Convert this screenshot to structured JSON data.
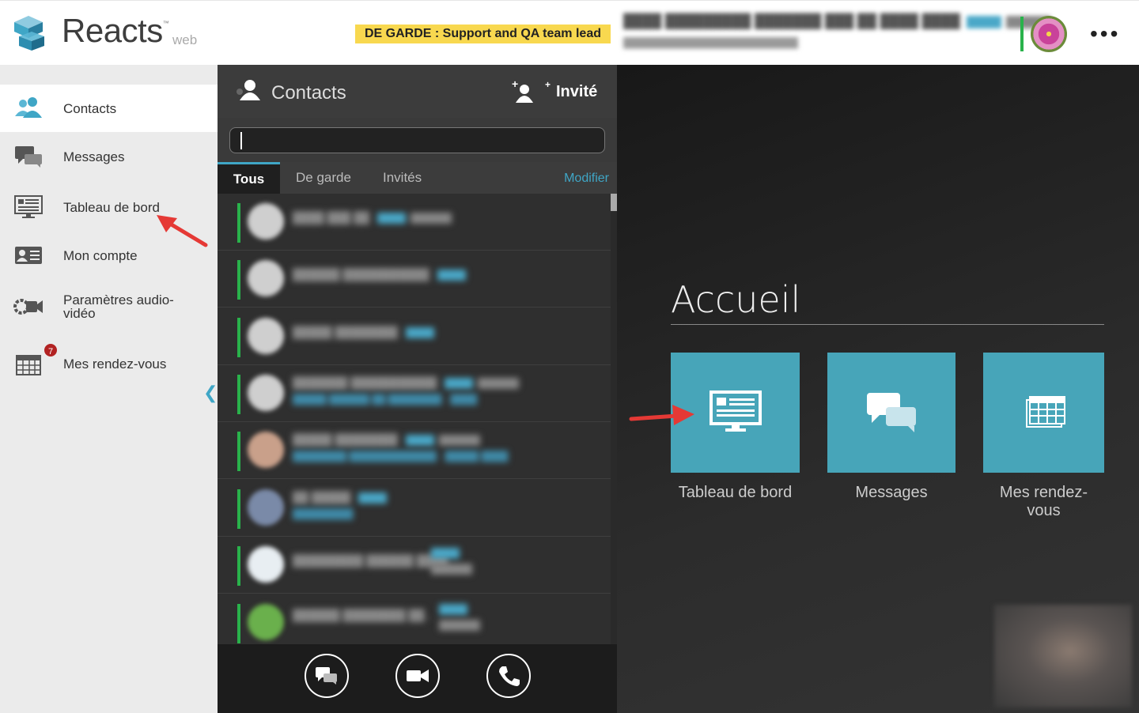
{
  "header": {
    "brand": "Reacts",
    "brand_tm": "™",
    "brand_suffix": "web",
    "oncall_banner": "DE GARDE : Support and QA team lead"
  },
  "sidebar": {
    "items": [
      {
        "label": "Contacts",
        "icon": "contacts-icon",
        "active": true
      },
      {
        "label": "Messages",
        "icon": "messages-icon"
      },
      {
        "label": "Tableau de bord",
        "icon": "dashboard-icon"
      },
      {
        "label": "Mon compte",
        "icon": "account-card-icon"
      },
      {
        "label": "Paramètres audio-vidéo",
        "icon": "camera-settings-icon"
      },
      {
        "label": "Mes rendez-vous",
        "icon": "calendar-icon",
        "badge": "7"
      }
    ],
    "collapse_glyph": "❮"
  },
  "contacts_panel": {
    "title": "Contacts",
    "invite_label": "Invité",
    "search_value": "",
    "tabs": [
      "Tous",
      "De garde",
      "Invités"
    ],
    "active_tab": "Tous",
    "modify_label": "Modifier"
  },
  "main": {
    "title": "Accueil",
    "tiles": [
      {
        "label": "Tableau de bord",
        "icon": "dashboard-icon"
      },
      {
        "label": "Messages",
        "icon": "messages-icon"
      },
      {
        "label": "Mes rendez-vous",
        "icon": "calendar-icon"
      }
    ]
  },
  "colors": {
    "accent": "#3fa6c6",
    "tile": "#47a5b9",
    "status_online": "#29b24b",
    "banner": "#f8d84f",
    "annotation_arrow": "#e53935"
  }
}
